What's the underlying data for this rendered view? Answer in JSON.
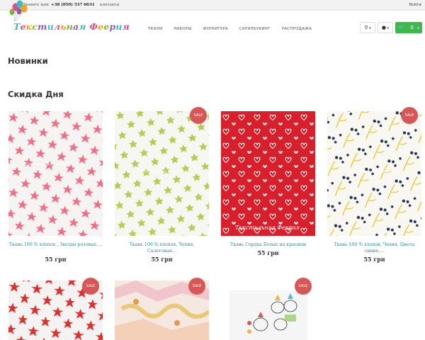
{
  "topbar": {
    "call_label": "Звоните нам:",
    "phone": "+38 (050) 537 6631",
    "contacts": "контакты",
    "login": "Войти"
  },
  "logo": {
    "text": "Текстильная Феерия",
    "colors": [
      "#3dbcc4",
      "#e04f8c",
      "#f2a31d",
      "#7bb63a",
      "#8e5bb0"
    ]
  },
  "nav": [
    "ТКАНИ",
    "НАБОРЫ",
    "ФУРНИТУРА",
    "СКРАПБУКИНГ",
    "РАСПРОДАЖА"
  ],
  "tools": {
    "search_icon": "search-icon",
    "user_icon": "user-icon",
    "cart_icon": "shopping-cart-icon",
    "cart_count": "0"
  },
  "sections": {
    "new": "Новинки",
    "sale": "Скидка Дня"
  },
  "badge_text": "SALE",
  "watermark": "Текстильная Феерия",
  "products": [
    {
      "name": "Ткань 100 % хлопок , Звезды розовые,...",
      "price": "55 грн",
      "sale": false
    },
    {
      "name": "Ткань 100 % хлопок, Чехия, Салатовые...",
      "price": "55 грн",
      "sale": true
    },
    {
      "name": "Ткань Сердца Белые на красном",
      "price": "55 грн",
      "sale": false
    },
    {
      "name": "Ткань 100 % хлопок, Чехия, Цветы синие,...",
      "price": "55 грн",
      "sale": true
    },
    {
      "name": "",
      "price": "",
      "sale": true
    },
    {
      "name": "",
      "price": "",
      "sale": true
    },
    {
      "name": "",
      "price": "",
      "sale": true
    }
  ],
  "colors": {
    "accent_green": "#3cb94a",
    "sale_badge": "#d75757",
    "link_teal": "#2a8a98"
  }
}
